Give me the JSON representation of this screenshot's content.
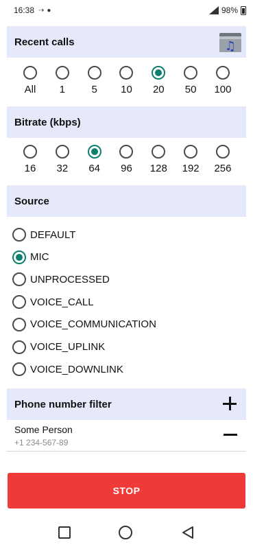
{
  "status": {
    "time": "16:38",
    "icons": [
      "usb-icon",
      "android-debug-icon"
    ],
    "battery": "98%"
  },
  "recent_calls": {
    "title": "Recent calls",
    "options": [
      "All",
      "1",
      "5",
      "10",
      "20",
      "50",
      "100"
    ],
    "selected": "20"
  },
  "bitrate": {
    "title": "Bitrate (kbps)",
    "options": [
      "16",
      "32",
      "64",
      "96",
      "128",
      "192",
      "256"
    ],
    "selected": "64"
  },
  "source": {
    "title": "Source",
    "options": [
      "DEFAULT",
      "MIC",
      "UNPROCESSED",
      "VOICE_CALL",
      "VOICE_COMMUNICATION",
      "VOICE_UPLINK",
      "VOICE_DOWNLINK"
    ],
    "selected": "MIC"
  },
  "filter": {
    "title": "Phone number filter",
    "contacts": [
      {
        "name": "Some Person",
        "number": "+1 234-567-89"
      }
    ]
  },
  "stop_label": "STOP",
  "colors": {
    "accent": "#0d7f6f",
    "header_bg": "#e6e9f9",
    "stop": "#ef3a3a"
  }
}
